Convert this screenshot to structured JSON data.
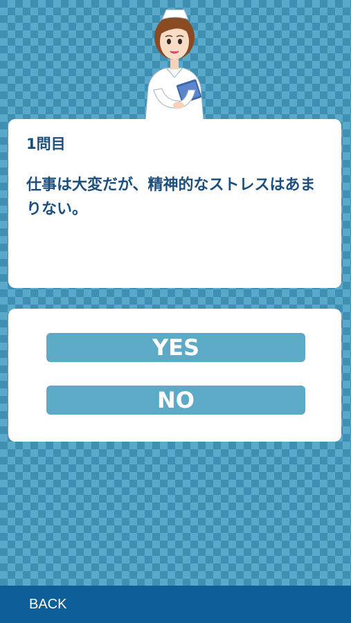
{
  "question": {
    "number_label": "1問目",
    "text": "仕事は大変だが、精神的なストレスはあまりない。"
  },
  "answers": {
    "yes_label": "YES",
    "no_label": "NO"
  },
  "footer": {
    "back_label": "BACK"
  },
  "colors": {
    "background": "#3f8fb3",
    "pattern": "#5aa9ca",
    "text": "#1a4f7f",
    "button": "#5daac7",
    "footer": "#0e5f98"
  }
}
